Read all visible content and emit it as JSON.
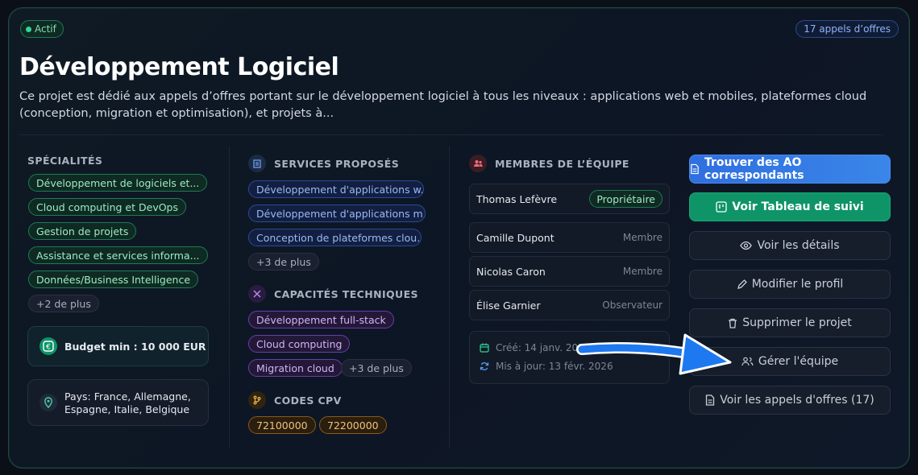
{
  "project": {
    "status": "Actif",
    "tenders_badge": "17 appels d’offres",
    "title": "Développement Logiciel",
    "description": "Ce projet est dédié aux appels d’offres portant sur le développement logiciel à tous les niveaux : applications web et mobiles, plateformes cloud (conception, migration et optimisation), et projets à..."
  },
  "specialites": {
    "title": "SPÉCIALITÉS",
    "tags": [
      "Développement de logiciels et...",
      "Cloud computing et DevOps",
      "Gestion de projets",
      "Assistance et services informa...",
      "Données/Business Intelligence"
    ],
    "more": "+2 de plus"
  },
  "budget": {
    "label": "Budget min : 10 000 EUR",
    "icon": "euro-icon"
  },
  "pays": {
    "line1": "Pays: France, Allemagne,",
    "line2": "Espagne, Italie, Belgique",
    "icon": "location-pin-icon"
  },
  "services": {
    "title": "SERVICES PROPOSÉS",
    "tags": [
      "Développement d'applications w...",
      "Développement d'applications m...",
      "Conception de plateformes clou..."
    ],
    "more": "+3 de plus"
  },
  "capacites": {
    "title": "CAPACITÉS TECHNIQUES",
    "tags": [
      "Développement full-stack",
      "Cloud computing",
      "Migration cloud"
    ],
    "more": "+3 de plus"
  },
  "cpv": {
    "title": "CODES CPV",
    "codes": [
      "72100000",
      "72200000"
    ]
  },
  "members": {
    "title": "MEMBRES DE L’ÉQUIPE",
    "list": [
      {
        "name": "Thomas Lefèvre",
        "role": "Propriétaire"
      },
      {
        "name": "Camille Dupont",
        "role": "Membre"
      },
      {
        "name": "Nicolas Caron",
        "role": "Membre"
      },
      {
        "name": "Élise Garnier",
        "role": "Observateur"
      }
    ]
  },
  "dates": {
    "created": "Créé: 14 janv. 2026",
    "updated": "Mis à jour: 13 févr. 2026"
  },
  "actions": {
    "find": "Trouver des AO correspondants",
    "board": "Voir Tableau de suivi",
    "details": "Voir les détails",
    "edit": "Modifier le profil",
    "delete": "Supprimer le projet",
    "team": "Gérer l'équipe",
    "tenders": "Voir les appels d'offres (17)"
  },
  "colors": {
    "accent_green": "#0f9468",
    "accent_blue": "#2f6fe0",
    "arrow": "#1e78f0"
  }
}
